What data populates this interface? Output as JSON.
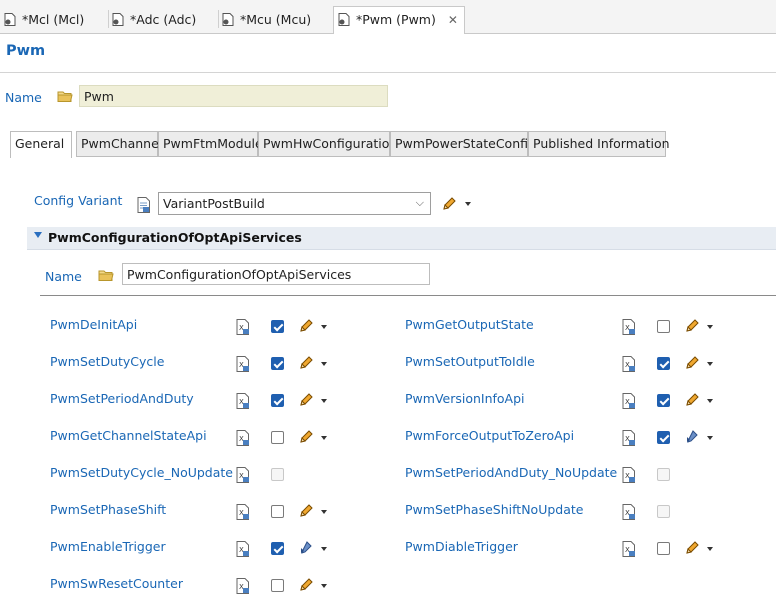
{
  "editor_tabs": [
    {
      "label": "*Mcl (Mcl)"
    },
    {
      "label": "*Adc (Adc)"
    },
    {
      "label": "*Mcu (Mcu)"
    },
    {
      "label": "*Pwm (Pwm)",
      "active": true,
      "close": "✕"
    }
  ],
  "header": {
    "title": "Pwm",
    "name_label": "Name",
    "name_value": "Pwm"
  },
  "page_tabs": [
    {
      "label": "General",
      "active": true
    },
    {
      "label": "PwmChannel"
    },
    {
      "label": "PwmFtmModule"
    },
    {
      "label": "PwmHwConfiguration"
    },
    {
      "label": "PwmPowerStateConfig"
    },
    {
      "label": "Published Information"
    }
  ],
  "config_variant": {
    "label": "Config Variant",
    "value": "VariantPostBuild"
  },
  "section": {
    "title": "PwmConfigurationOfOptApiServices",
    "name_label": "Name",
    "name_value": "PwmConfigurationOfOptApiServices"
  },
  "params_left": [
    {
      "name": "PwmDeInitApi",
      "state": "checked",
      "icon": "pencil-icon"
    },
    {
      "name": "PwmSetDutyCycle",
      "state": "checked",
      "icon": "pencil-icon"
    },
    {
      "name": "PwmSetPeriodAndDuty",
      "state": "checked",
      "icon": "pencil-icon"
    },
    {
      "name": "PwmGetChannelStateApi",
      "state": "unchecked",
      "icon": "pencil-icon"
    },
    {
      "name": "PwmSetDutyCycle_NoUpdate",
      "state": "disabled",
      "icon": "none"
    },
    {
      "name": "PwmSetPhaseShift",
      "state": "unchecked",
      "icon": "pencil-icon"
    },
    {
      "name": "PwmEnableTrigger",
      "state": "checked",
      "icon": "calculated-icon"
    },
    {
      "name": "PwmSwResetCounter",
      "state": "unchecked",
      "icon": "pencil-icon"
    }
  ],
  "params_right": [
    {
      "name": "PwmGetOutputState",
      "state": "unchecked",
      "icon": "pencil-icon"
    },
    {
      "name": "PwmSetOutputToIdle",
      "state": "checked",
      "icon": "pencil-icon"
    },
    {
      "name": "PwmVersionInfoApi",
      "state": "checked",
      "icon": "pencil-icon"
    },
    {
      "name": "PwmForceOutputToZeroApi",
      "state": "checked",
      "icon": "calculated-icon"
    },
    {
      "name": "PwmSetPeriodAndDuty_NoUpdate",
      "state": "disabled",
      "icon": "none"
    },
    {
      "name": "PwmSetPhaseShiftNoUpdate",
      "state": "disabled",
      "icon": "none"
    },
    {
      "name": "PwmDiableTrigger",
      "state": "unchecked",
      "icon": "pencil-icon"
    }
  ],
  "colors": {
    "link_blue": "#1a67b5",
    "check_blue": "#1f5fb0",
    "name_field_bg": "#f0efd8"
  }
}
